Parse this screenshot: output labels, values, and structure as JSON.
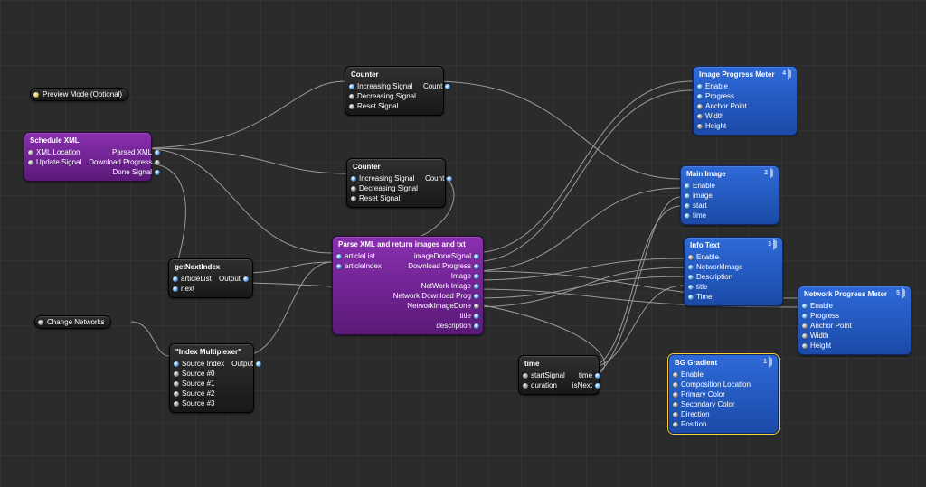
{
  "pills": {
    "preview": "Preview Mode (Optional)",
    "change": "Change Networks"
  },
  "nodes": {
    "schedule": {
      "title": "Schedule XML",
      "in": [
        "XML Location",
        "Update Signal"
      ],
      "out": [
        "Parsed XML",
        "Download Progress",
        "Done Signal"
      ]
    },
    "counter1": {
      "title": "Counter",
      "in": [
        "Increasing Signal",
        "Decreasing Signal",
        "Reset Signal"
      ],
      "out": [
        "Count"
      ]
    },
    "counter2": {
      "title": "Counter",
      "in": [
        "Increasing Signal",
        "Decreasing Signal",
        "Reset Signal"
      ],
      "out": [
        "Count"
      ]
    },
    "getNext": {
      "title": "getNextIndex",
      "in": [
        "articleList",
        "next"
      ],
      "out": [
        "Output"
      ]
    },
    "mux": {
      "title": "\"Index Multiplexer\"",
      "in": [
        "Source Index",
        "Source #0",
        "Source #1",
        "Source #2",
        "Source #3"
      ],
      "out": [
        "Output"
      ]
    },
    "parse": {
      "title": "Parse XML and return images and txt",
      "in": [
        "articleList",
        "articleIndex"
      ],
      "out": [
        "imageDoneSignal",
        "Download Progress",
        "Image",
        "NetWork Image",
        "Network Download Prog",
        "NetworkImageDone",
        "title",
        "description"
      ]
    },
    "time": {
      "title": "time",
      "in": [
        "startSignal",
        "duration"
      ],
      "out": [
        "time",
        "isNext"
      ]
    },
    "imgProg": {
      "title": "Image Progress Meter",
      "idx": "4",
      "in": [
        "Enable",
        "Progress",
        "Anchor Point",
        "Width",
        "Height"
      ]
    },
    "mainImg": {
      "title": "Main Image",
      "idx": "2",
      "in": [
        "Enable",
        "image",
        "start",
        "time"
      ]
    },
    "infoText": {
      "title": "Info Text",
      "idx": "3",
      "in": [
        "Enable",
        "NetworkImage",
        "Description",
        "title",
        "Time"
      ]
    },
    "netProg": {
      "title": "Network Progress Meter",
      "idx": "5",
      "in": [
        "Enable",
        "Progress",
        "Anchor Point",
        "Width",
        "Height"
      ]
    },
    "bgGrad": {
      "title": "BG Gradient",
      "idx": "1",
      "in": [
        "Enable",
        "Composition Location",
        "Primary Color",
        "Secondary Color",
        "Direction",
        "Position"
      ]
    }
  }
}
